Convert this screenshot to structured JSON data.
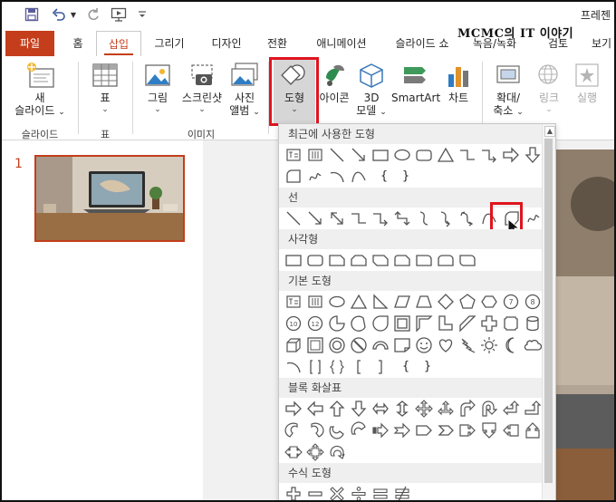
{
  "window": {
    "title_right": "프레젠",
    "watermark": "MCMC의 IT 이야기"
  },
  "tabs": [
    {
      "label": "파일",
      "key": "file"
    },
    {
      "label": "홈",
      "key": "home"
    },
    {
      "label": "삽입",
      "key": "insert",
      "active": true
    },
    {
      "label": "그리기",
      "key": "draw"
    },
    {
      "label": "디자인",
      "key": "design"
    },
    {
      "label": "전환",
      "key": "transitions"
    },
    {
      "label": "애니메이션",
      "key": "animations"
    },
    {
      "label": "슬라이드 쇼",
      "key": "slideshow"
    },
    {
      "label": "녹음/녹화",
      "key": "record"
    },
    {
      "label": "검토",
      "key": "review"
    },
    {
      "label": "보기",
      "key": "view"
    }
  ],
  "ribbon": {
    "new_slide_1": "새",
    "new_slide_2": "슬라이드",
    "table": "표",
    "picture": "그림",
    "screenshot": "스크린샷",
    "album_1": "사진",
    "album_2": "앨범",
    "shapes": "도형",
    "icons": "아이콘",
    "model_1": "3D",
    "model_2": "모델",
    "smartart": "SmartArt",
    "chart": "차트",
    "zoom_1": "확대/",
    "zoom_2": "축소",
    "link": "링크",
    "action": "실행",
    "group_slides": "슬라이드",
    "group_table": "표",
    "group_images": "이미지"
  },
  "slides": {
    "current_number": "1"
  },
  "shapes_menu": {
    "sections": {
      "recent": "최근에 사용한 도형",
      "lines": "선",
      "rectangles": "사각형",
      "basic": "기본 도형",
      "block_arrows": "블록 화살표",
      "equation": "수식 도형"
    },
    "brace_left": "{",
    "brace_right": "}"
  },
  "colors": {
    "accent": "#c43e1c",
    "highlight": "#e0141e"
  }
}
